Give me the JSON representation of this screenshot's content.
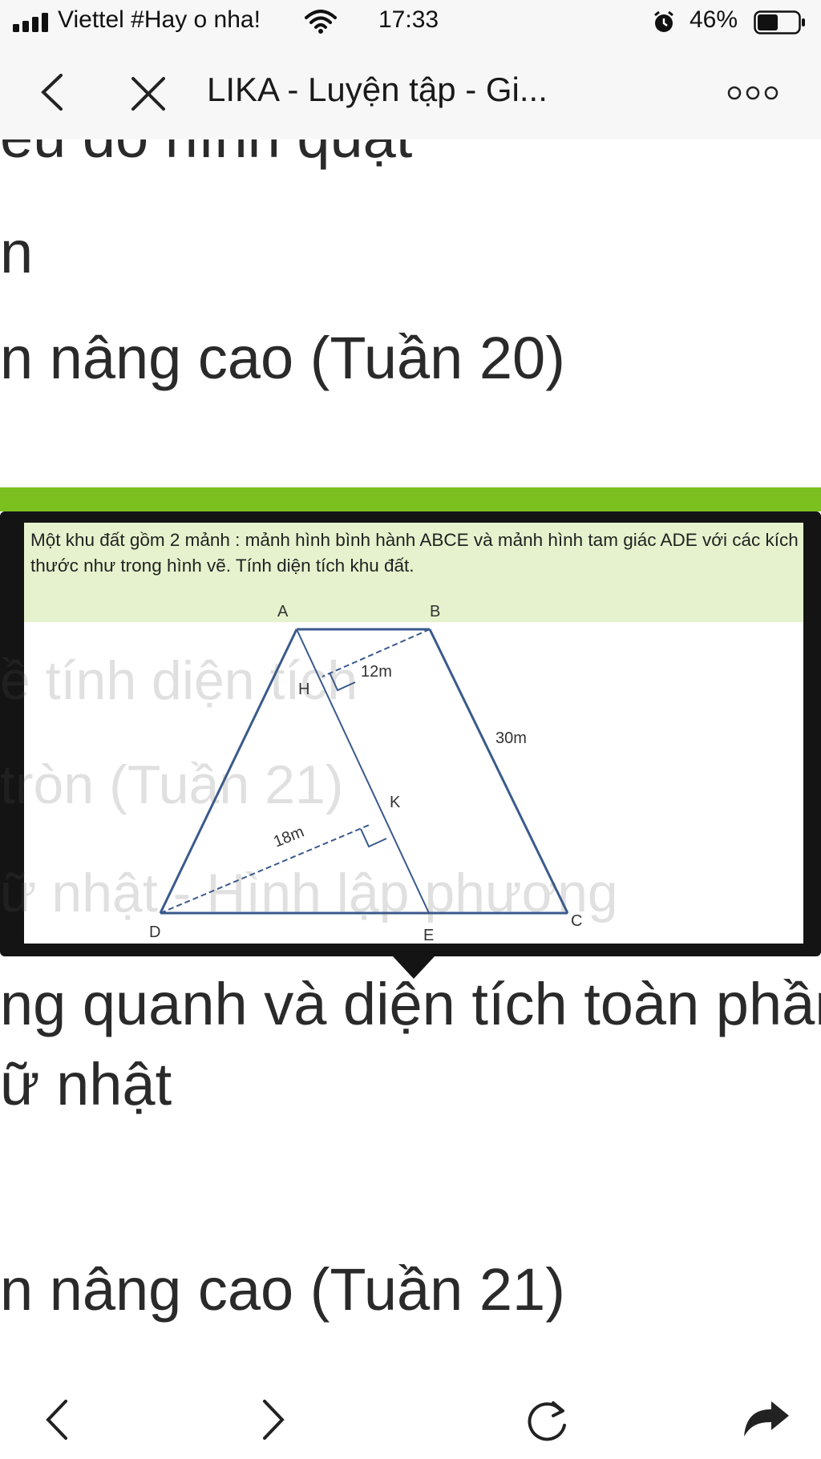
{
  "status_bar": {
    "carrier": "Viettel #Hay o nha!",
    "time": "17:33",
    "battery": "46%",
    "icons": [
      "signal-icon",
      "wifi-icon",
      "alarm-icon",
      "battery-icon"
    ]
  },
  "nav_bar": {
    "title": "LIKA - Luyện tập - Gi...",
    "icons": [
      "back-icon",
      "close-icon",
      "more-icon"
    ]
  },
  "page": {
    "lines": [
      "ểu đồ hình quạt",
      "n",
      "n nâng cao (Tuần 20)",
      "ng quanh và diện tích toàn phần",
      "ữ nhật",
      "n nâng cao (Tuần 21)"
    ],
    "faded_lines": [
      "ề tính diện tích",
      "tròn (Tuần 21)",
      "ữ nhật - Hình lập phương"
    ]
  },
  "question": {
    "text": "Một khu đất gồm 2 mảnh : mảnh hình bình hành ABCE và mảnh hình tam giác ADE với các kích thước như trong hình vẽ. Tính diện tích khu đất.",
    "figure": {
      "points": [
        "A",
        "B",
        "C",
        "D",
        "E",
        "H",
        "K"
      ],
      "measure_ah": "12m",
      "measure_bc": "30m",
      "measure_dk": "18m"
    }
  },
  "bottom_bar": {
    "icons": [
      "back-arrow-icon",
      "forward-arrow-icon",
      "reload-icon",
      "share-icon"
    ]
  },
  "colors": {
    "accent_green": "#7bc01f",
    "header_green": "#e6f2cd",
    "figure_blue": "#3a5a8c"
  }
}
